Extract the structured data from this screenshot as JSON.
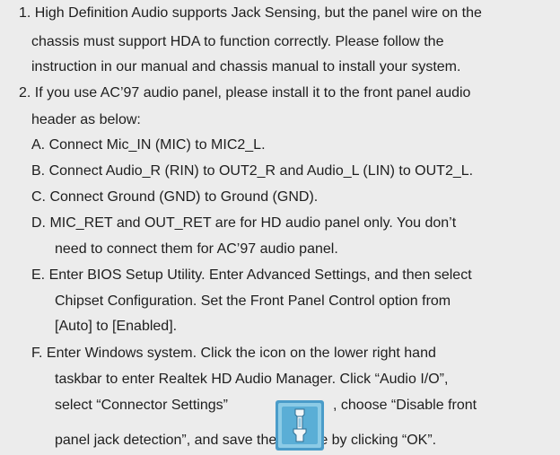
{
  "instructions": {
    "item1": {
      "line1": "1. High Definition Audio supports Jack Sensing, but the panel wire on the",
      "line2": "chassis must support HDA to function correctly. Please follow the",
      "line3": "instruction in our manual and chassis manual to install your system."
    },
    "item2": {
      "line1": "2. If you use AC’97 audio panel, please install it to the front panel audio",
      "line2": "header as below:"
    },
    "stepA": "A. Connect Mic_IN (MIC) to MIC2_L.",
    "stepB": "B. Connect Audio_R (RIN) to OUT2_R and Audio_L (LIN) to OUT2_L.",
    "stepC": "C. Connect Ground (GND) to Ground (GND).",
    "stepD": {
      "line1": "D. MIC_RET and OUT_RET are for HD audio panel only. You don’t",
      "line2": "need to connect them for AC’97 audio panel."
    },
    "stepE": {
      "line1": "E. Enter BIOS Setup Utility. Enter Advanced Settings, and then select",
      "line2": "Chipset Configuration. Set the Front Panel Control option from",
      "line3": "[Auto] to [Enabled]."
    },
    "stepF": {
      "line1": "F. Enter Windows system. Click the icon on the lower right hand",
      "line2": "taskbar to enter Realtek HD Audio Manager. Click “Audio I/O”,",
      "line3a": "select “Connector Settings”",
      "line3b": ", choose “Disable front",
      "line4": "panel jack detection”, and save the change by clicking “OK”."
    }
  },
  "icon": {
    "name": "connector-settings-icon",
    "colors": {
      "frame_outer": "#4a9cc9",
      "frame_inner": "#8ccbe6",
      "panel": "#5aaed6",
      "tool": "#f2f6f8"
    }
  }
}
